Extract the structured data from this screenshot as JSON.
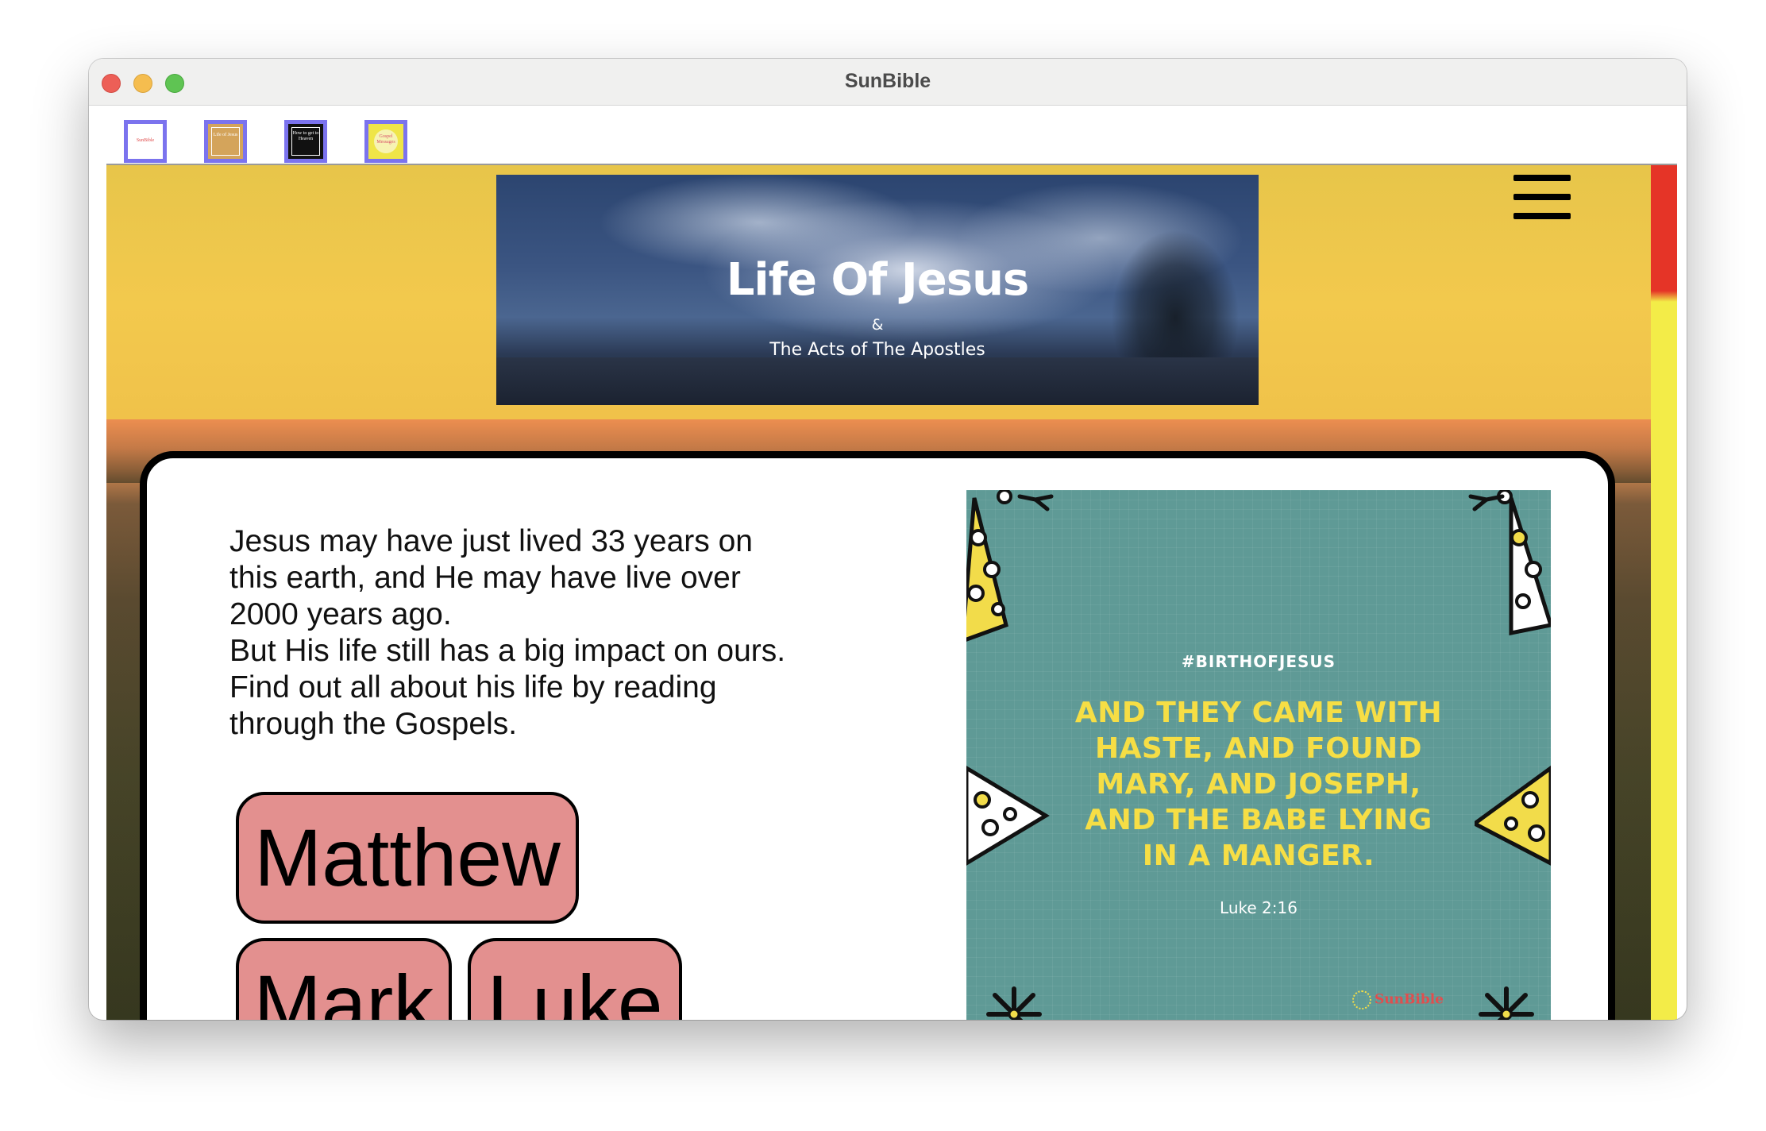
{
  "window": {
    "title": "SunBible"
  },
  "tabs": [
    {
      "label": "SunBible"
    },
    {
      "label": "Life of Jesus"
    },
    {
      "label": "How to get to Heaven"
    },
    {
      "label": "Gospel Messages"
    }
  ],
  "header": {
    "banner_title": "Life Of Jesus",
    "banner_amp": "&",
    "banner_subtitle": "The Acts of The Apostles",
    "menu_icon": "hamburger-menu-icon"
  },
  "intro": {
    "lines": [
      "Jesus may have just lived 33 years on",
      "this earth, and He may have live over",
      "2000 years ago.",
      "But His life still has a big impact on ours.",
      "Find out all about his life by reading",
      "through the Gospels."
    ]
  },
  "gospels": [
    {
      "label": "Matthew"
    },
    {
      "label": "Mark"
    },
    {
      "label": "Luke"
    }
  ],
  "verse_card": {
    "hashtag": "#BIRTHOFJESUS",
    "lines": [
      "AND THEY CAME WITH",
      "HASTE, AND FOUND",
      "MARY, AND JOSEPH,",
      "AND THE BABE LYING",
      "IN A MANGER."
    ],
    "reference": "Luke 2:16",
    "logo_text": "SunBible"
  },
  "colors": {
    "accent_yellow": "#e8c447",
    "scroll_thumb": "#e53427",
    "scroll_track": "#f3ec48",
    "button_fill": "#e3908f",
    "verse_bg": "#5f9a96",
    "verse_text": "#f6de45",
    "tab_border": "#7b73ee"
  }
}
